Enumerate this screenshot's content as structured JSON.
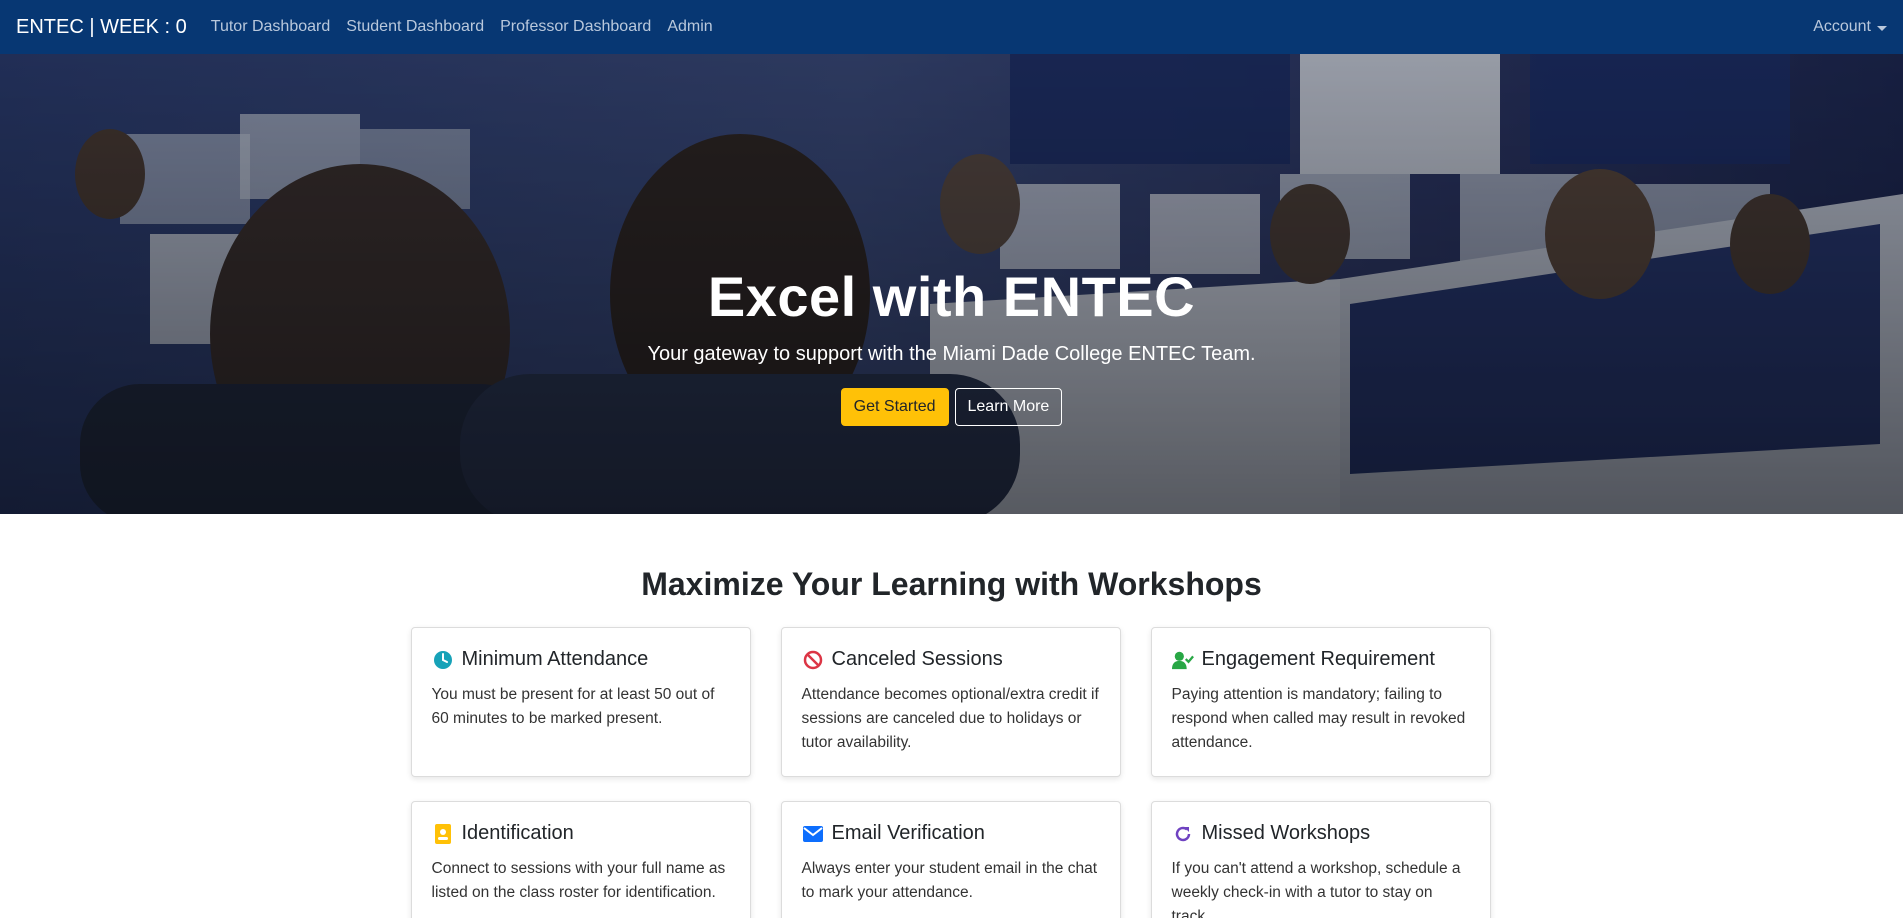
{
  "navbar": {
    "brand": "ENTEC | WEEK : 0",
    "links": [
      "Tutor Dashboard",
      "Student Dashboard",
      "Professor Dashboard",
      "Admin"
    ],
    "account": "Account"
  },
  "hero": {
    "title": "Excel with ENTEC",
    "subtitle": "Your gateway to support with the Miami Dade College ENTEC Team.",
    "primary_button": "Get Started",
    "secondary_button": "Learn More"
  },
  "section": {
    "title": "Maximize Your Learning with Workshops"
  },
  "cards": [
    {
      "icon": "clock-icon",
      "color": "#17a2b8",
      "title": "Minimum Attendance",
      "text": "You must be present for at least 50 out of 60 minutes to be marked present."
    },
    {
      "icon": "ban-icon",
      "color": "#dc3545",
      "title": "Canceled Sessions",
      "text": "Attendance becomes optional/extra credit if sessions are canceled due to holidays or tutor availability."
    },
    {
      "icon": "user-check-icon",
      "color": "#28a745",
      "title": "Engagement Requirement",
      "text": "Paying attention is mandatory; failing to respond when called may result in revoked attendance."
    },
    {
      "icon": "id-badge-icon",
      "color": "#ffc107",
      "title": "Identification",
      "text": "Connect to sessions with your full name as listed on the class roster for identification."
    },
    {
      "icon": "envelope-icon",
      "color": "#0d6efd",
      "title": "Email Verification",
      "text": "Always enter your student email in the chat to mark your attendance."
    },
    {
      "icon": "redo-icon",
      "color": "#6f42c1",
      "title": "Missed Workshops",
      "text": "If you can't attend a workshop, schedule a weekly check-in with a tutor to stay on track."
    }
  ]
}
